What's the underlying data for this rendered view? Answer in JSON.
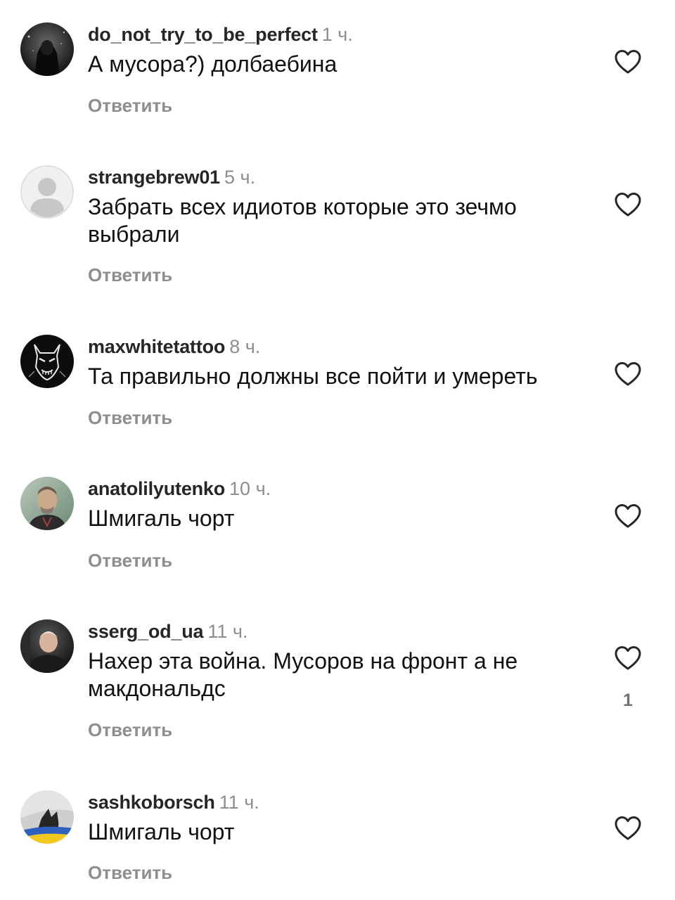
{
  "comments": [
    {
      "avatar": "dark-hooded-figure-avatar",
      "username": "do_not_try_to_be_perfect",
      "time": "1 ч.",
      "text": "А мусора?) долбаебина",
      "reply_label": "Ответить",
      "like_count": ""
    },
    {
      "avatar": "default-person-avatar",
      "username": "strangebrew01",
      "time": "5 ч.",
      "text": "Забрать всех идиотов которые это зечмо выбрали",
      "reply_label": "Ответить",
      "like_count": ""
    },
    {
      "avatar": "oni-mask-avatar",
      "username": "maxwhitetattoo",
      "time": "8 ч.",
      "text": "Та правильно должны все пойти и умереть",
      "reply_label": "Ответить",
      "like_count": ""
    },
    {
      "avatar": "portrait-painting-avatar",
      "username": "anatolilyutenko",
      "time": "10 ч.",
      "text": "Шмигаль чорт",
      "reply_label": "Ответить",
      "like_count": ""
    },
    {
      "avatar": "man-photo-avatar",
      "username": "sserg_od_ua",
      "time": "11 ч.",
      "text": "Нахер эта война. Мусоров на фронт а не макдональдс",
      "reply_label": "Ответить",
      "like_count": "1"
    },
    {
      "avatar": "cat-with-flag-avatar",
      "username": "sashkoborsch",
      "time": "11 ч.",
      "text": "Шмигаль чорт",
      "reply_label": "Ответить",
      "like_count": ""
    }
  ],
  "colors": {
    "username": "#262626",
    "secondary": "#8e8e8e",
    "text": "#111111",
    "heart_stroke": "#262626"
  }
}
